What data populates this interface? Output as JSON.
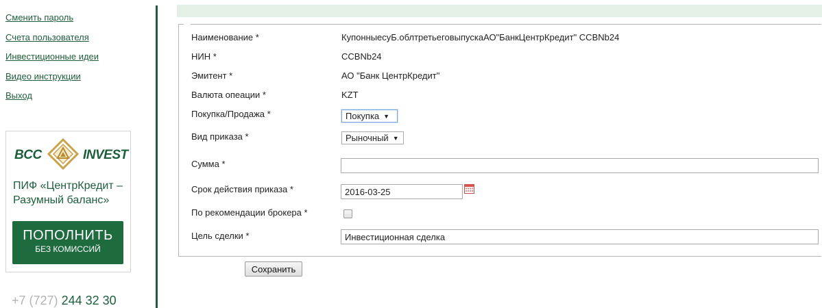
{
  "nav": {
    "links": [
      "Сменить пароль",
      "Счета пользователя",
      "Инвестиционные идеи",
      "Видео инструкции",
      "Выход"
    ]
  },
  "promo": {
    "logo_left": "BCC",
    "logo_right": "INVEST",
    "text": "ПИФ «ЦентрКредит – Разумный баланс»",
    "button_line1": "ПОПОЛНИТЬ",
    "button_line2": "БЕЗ КОМИССИЙ"
  },
  "phone": {
    "code": "+7 (727)",
    "number": "244 32 30"
  },
  "form": {
    "name_label": "Наименование *",
    "name_value": "КупонныесуБ.облтретьеговыпускаАО\"БанкЦентрКредит\" CCBNb24",
    "nin_label": "НИН *",
    "nin_value": "CCBNb24",
    "issuer_label": "Эмитент *",
    "issuer_value": "АО \"Банк ЦентрКредит\"",
    "currency_label": "Валюта опеации *",
    "currency_value": "KZT",
    "side_label": "Покупка/Продажа *",
    "side_selected": "Покупка",
    "order_type_label": "Вид приказа *",
    "order_type_selected": "Рыночный",
    "amount_label": "Сумма *",
    "amount_value": "",
    "expiry_label": "Срок действия приказа *",
    "expiry_value": "2016-03-25",
    "broker_rec_label": "По рекомендации брокера *",
    "broker_rec_checked": false,
    "purpose_label": "Цель сделки *",
    "purpose_value": "Инвестиционная сделка",
    "save_label": "Сохранить"
  },
  "icons": {
    "calendar": "calendar-icon",
    "select_arrow": "triangle-down-icon",
    "logo_emblem": "bcc-emblem-icon"
  },
  "colors": {
    "brand_green": "#1b5e3b",
    "topbar": "#e4f0e6",
    "button_green": "#1e6b3f"
  }
}
